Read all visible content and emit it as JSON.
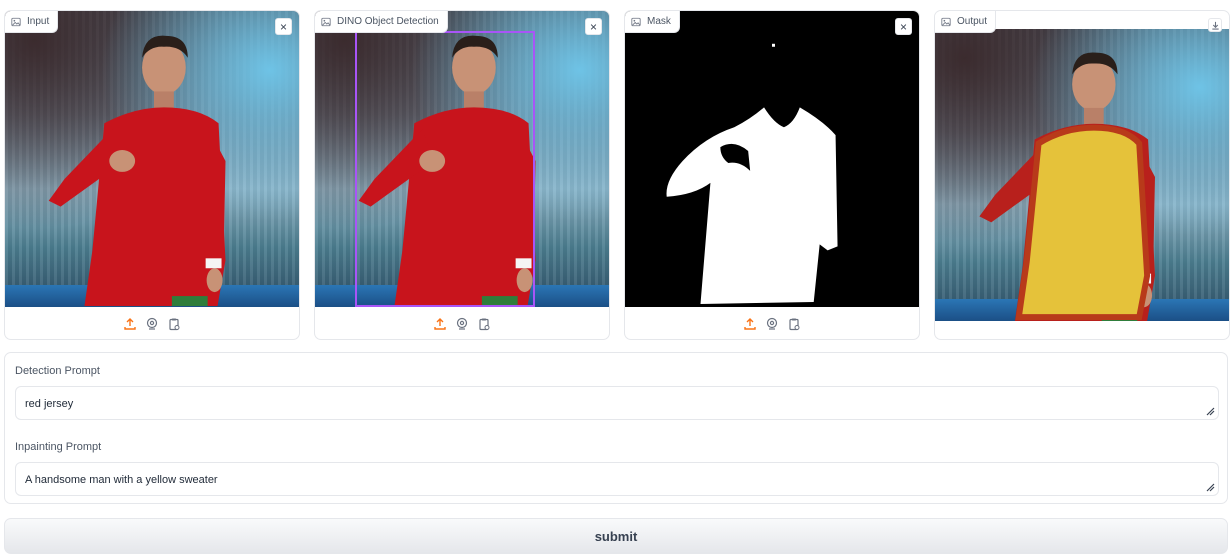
{
  "panels": [
    {
      "label": "Input",
      "close": "×"
    },
    {
      "label": "DINO Object Detection",
      "close": "×"
    },
    {
      "label": "Mask",
      "close": "×"
    },
    {
      "label": "Output"
    }
  ],
  "image_icon": "image-icon",
  "toolbar_icons": [
    "upload-icon",
    "webcam-icon",
    "clipboard-icon"
  ],
  "form": {
    "detection_label": "Detection Prompt",
    "detection_value": "red jersey",
    "inpainting_label": "Inpainting Prompt",
    "inpainting_value": "A handsome man with a yellow sweater"
  },
  "submit_label": "submit",
  "colors": {
    "accent_orange": "#f97316",
    "detection_box": "#a855f7",
    "jersey_red": "#c8141c",
    "sweater_yellow": "#e5c23a"
  }
}
